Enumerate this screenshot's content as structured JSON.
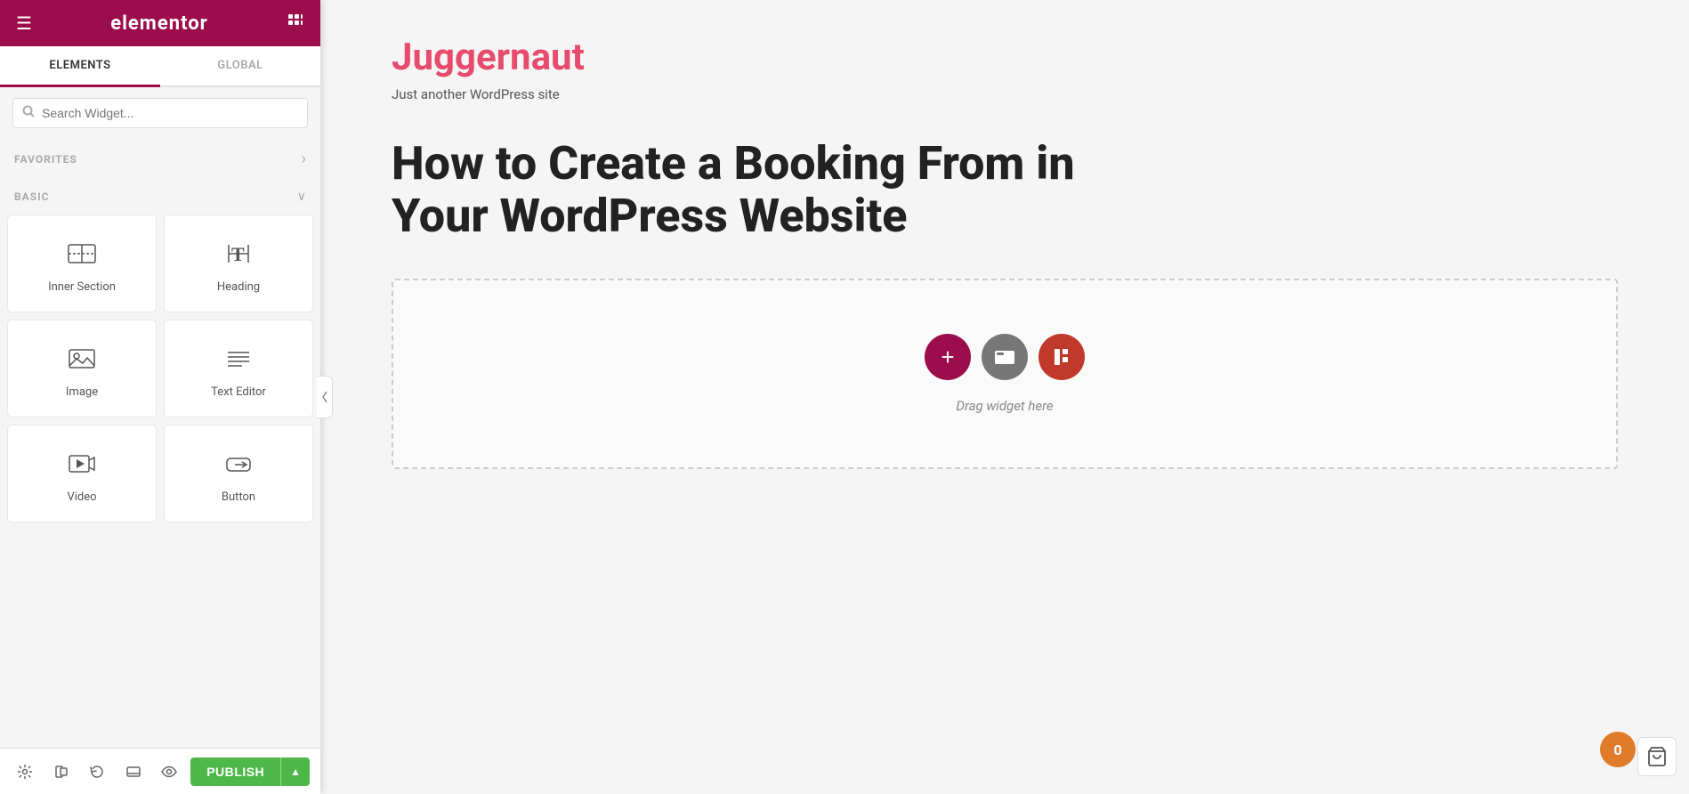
{
  "header": {
    "logo_text": "elementor",
    "hamburger_unicode": "☰",
    "grid_unicode": "⋮⋮⋮"
  },
  "tabs": {
    "elements_label": "ELEMENTS",
    "global_label": "GLOBAL",
    "active": "elements"
  },
  "search": {
    "placeholder": "Search Widget..."
  },
  "favorites": {
    "label": "FAVORITES",
    "chevron": "›"
  },
  "basic": {
    "label": "BASIC",
    "chevron": "∨"
  },
  "widgets": [
    {
      "id": "inner-section",
      "label": "Inner Section",
      "icon_type": "inner-section"
    },
    {
      "id": "heading",
      "label": "Heading",
      "icon_type": "heading"
    },
    {
      "id": "image",
      "label": "Image",
      "icon_type": "image"
    },
    {
      "id": "text-editor",
      "label": "Text Editor",
      "icon_type": "text-editor"
    },
    {
      "id": "video",
      "label": "Video",
      "icon_type": "video"
    },
    {
      "id": "button",
      "label": "Button",
      "icon_type": "button"
    }
  ],
  "toolbar": {
    "settings_icon": "⚙",
    "layers_icon": "◧",
    "history_icon": "↺",
    "responsive_icon": "⬜",
    "preview_icon": "👁",
    "publish_label": "PUBLISH",
    "publish_arrow": "▲"
  },
  "canvas": {
    "site_title": "Juggernaut",
    "site_tagline": "Just another WordPress site",
    "post_title": "How to Create a Booking From in Your WordPress Website",
    "drag_widget_text": "Drag widget here"
  },
  "drop_buttons": {
    "add_icon": "+",
    "folder_icon": "▤",
    "elementor_icon": "⊲"
  },
  "notification": {
    "count": "0"
  }
}
